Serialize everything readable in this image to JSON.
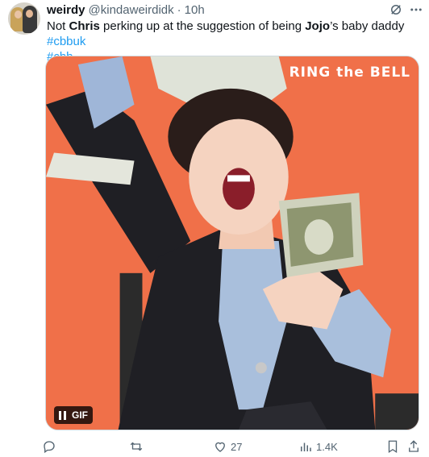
{
  "user": {
    "display_name": "weirdy",
    "handle": "@kindaweirdidk",
    "separator": "·",
    "time": "10h"
  },
  "tweet": {
    "parts": [
      {
        "text": "Not ",
        "bold": false
      },
      {
        "text": "Chris",
        "bold": true
      },
      {
        "text": " perking up at the suggestion of being ",
        "bold": false
      },
      {
        "text": "Jojo",
        "bold": true
      },
      {
        "text": "’s baby daddy ",
        "bold": false
      }
    ],
    "hashtags": [
      "#cbbuk",
      "#cbb"
    ]
  },
  "media": {
    "brand": "RING the BELL",
    "gif_label": "GIF",
    "accent_bg": "#f07049"
  },
  "actions": {
    "reply_count": "",
    "retweet_count": "",
    "like_count": "27",
    "views_count": "1.4K"
  },
  "colors": {
    "text": "#0f1419",
    "secondary": "#536471",
    "link": "#1d9bf0"
  }
}
